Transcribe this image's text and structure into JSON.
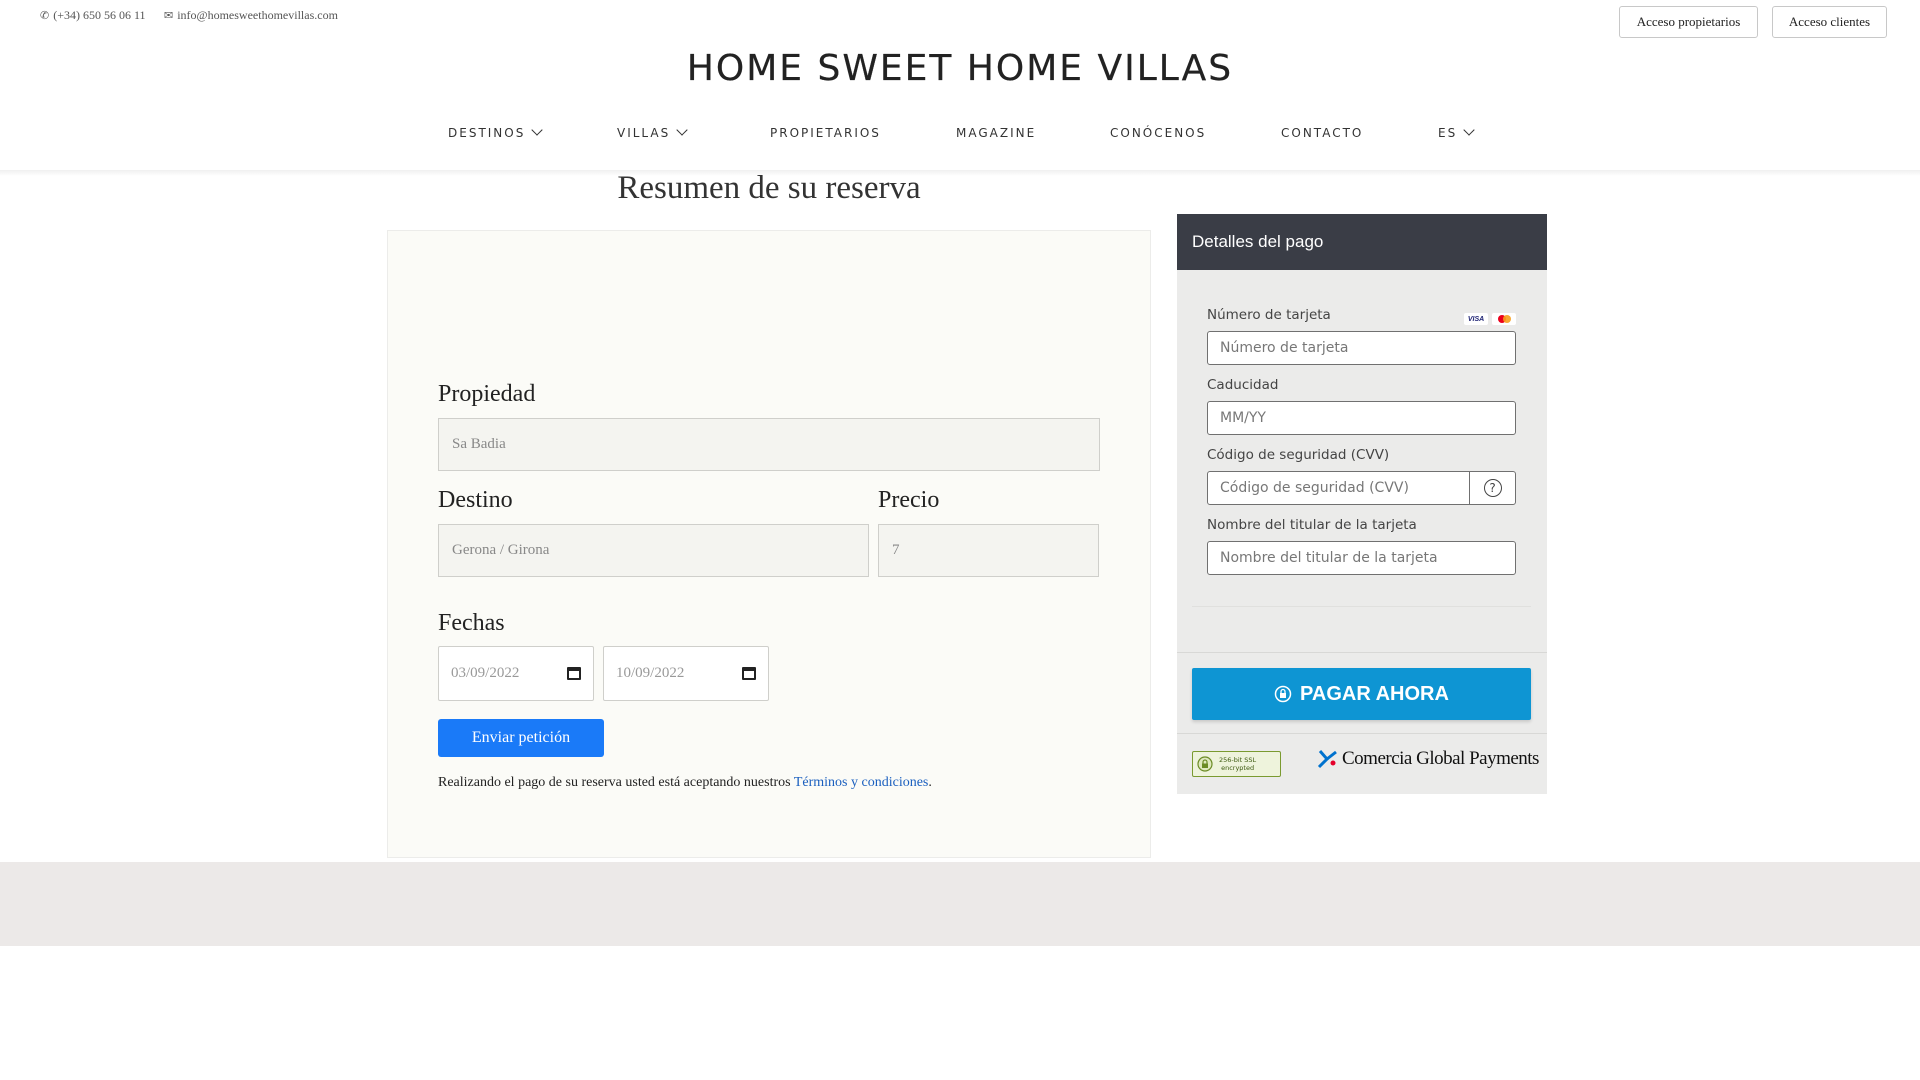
{
  "topbar": {
    "phone": "(+34) 650 56 06 11",
    "email": "info@homesweethomevillas.com",
    "owners_access": "Acceso propietarios",
    "clients_access": "Acceso clientes"
  },
  "brand": {
    "logo_text": "HOME SWEET HOME VILLAS"
  },
  "nav": {
    "destinos": "DESTINOS",
    "villas": "VILLAS",
    "propietarios": "PROPIETARIOS",
    "magazine": "MAGAZINE",
    "conocenos": "CONÓCENOS",
    "contacto": "CONTACTO",
    "language": "ES"
  },
  "summary": {
    "title": "Resumen de su reserva",
    "property_label": "Propiedad",
    "property_value": "Sa Badia",
    "destination_label": "Destino",
    "destination_value": "Gerona / Girona",
    "price_label": "Precio",
    "price_value": "7",
    "dates_label": "Fechas",
    "date_from": "03/09/2022",
    "date_to": "10/09/2022",
    "send_button": "Enviar petición",
    "terms_text": "Realizando el pago de su reserva usted está aceptando nuestros ",
    "terms_link": "Términos y condiciones",
    "terms_end": "."
  },
  "payment": {
    "header": "Detalles del pago",
    "card_number_label": "Número de tarjeta",
    "card_number_placeholder": "Número de tarjeta",
    "expiry_label": "Caducidad",
    "expiry_placeholder": "MM/YY",
    "cvv_label": "Código de seguridad (CVV)",
    "cvv_placeholder": "Código de seguridad (CVV)",
    "holder_label": "Nombre del titular de la tarjeta",
    "holder_placeholder": "Nombre del titular de la tarjeta",
    "visa_text": "VISA",
    "pay_button": "PAGAR AHORA",
    "ssl_line1": "256-bit SSL",
    "ssl_line2": "encrypted",
    "provider": "Comercia Global Payments",
    "colors": {
      "header": "#3a3d46",
      "pay_button": "#0e95d3",
      "send_button": "#1a7af8"
    }
  }
}
